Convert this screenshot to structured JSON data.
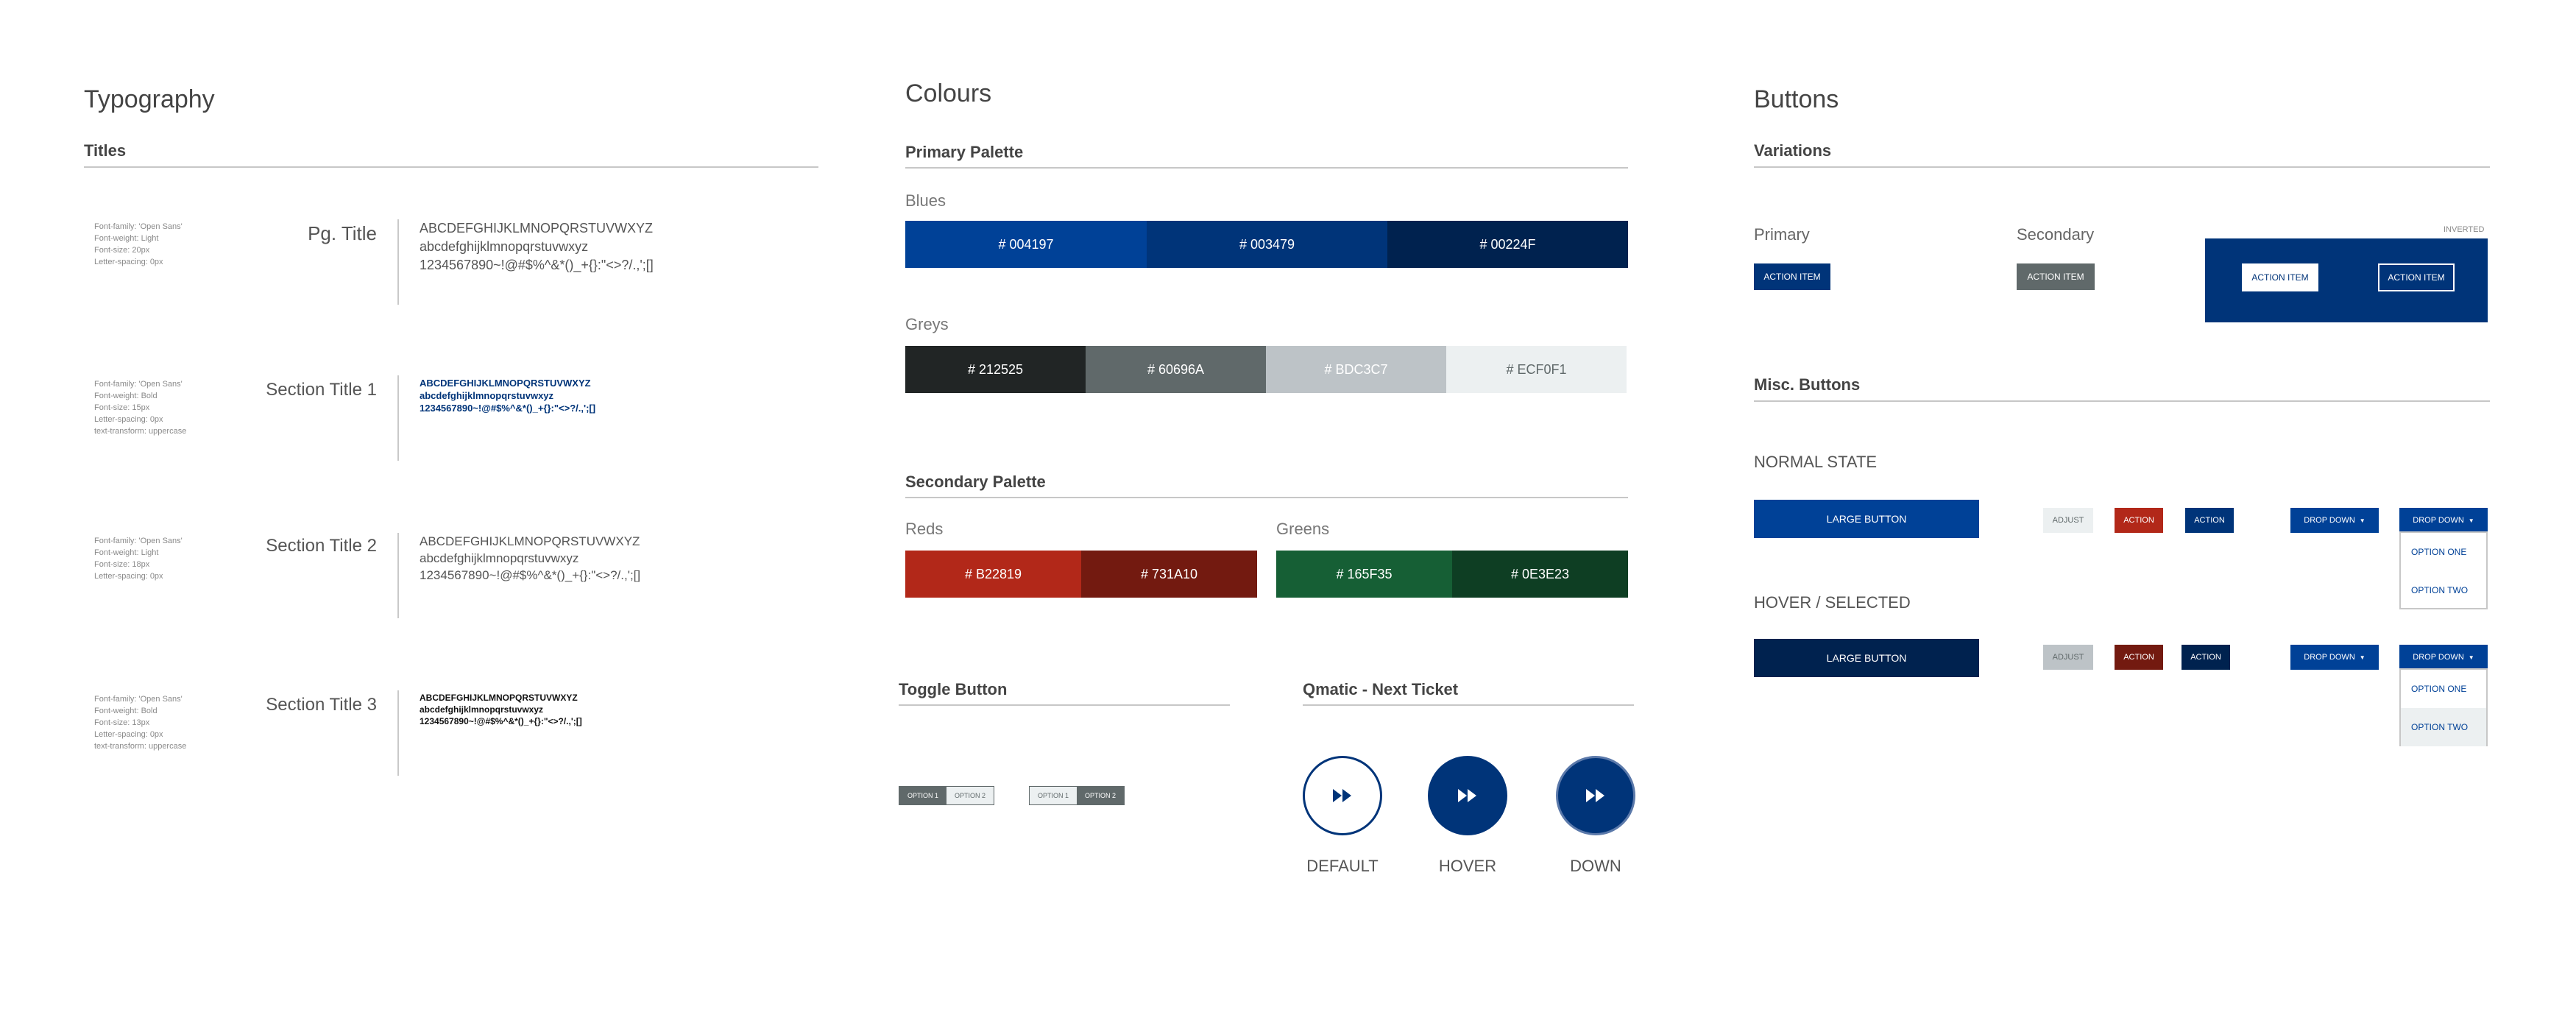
{
  "typography": {
    "heading": "Typography",
    "titles_heading": "Titles",
    "rows": [
      {
        "spec": "Font-family: 'Open Sans'\nFont-weight: Light\nFont-size: 20px\nLetter-spacing: 0px",
        "name": "Pg. Title",
        "sample": "ABCDEFGHIJKLMNOPQRSTUVWXYZ\nabcdefghijklmnopqrstuvwxyz\n1234567890~!@#$%^&*()_+{}:\"<>?/.,';[]"
      },
      {
        "spec": "Font-family: 'Open Sans'\nFont-weight: Bold\nFont-size: 15px\nLetter-spacing: 0px\ntext-transform: uppercase",
        "name": "Section Title 1",
        "sample": "ABCDEFGHIJKLMNOPQRSTUVWXYZ\nabcdefghijklmnopqrstuvwxyz\n1234567890~!@#$%^&*()_+{}:\"<>?/.,';[]"
      },
      {
        "spec": "Font-family: 'Open Sans'\nFont-weight: Light\nFont-size: 18px\nLetter-spacing: 0px",
        "name": "Section Title 2",
        "sample": "ABCDEFGHIJKLMNOPQRSTUVWXYZ\nabcdefghijklmnopqrstuvwxyz\n1234567890~!@#$%^&*()_+{}:\"<>?/.,';[]"
      },
      {
        "spec": "Font-family: 'Open Sans'\nFont-weight: Bold\nFont-size: 13px\nLetter-spacing: 0px\ntext-transform: uppercase",
        "name": "Section Title 3",
        "sample": "ABCDEFGHIJKLMNOPQRSTUVWXYZ\nabcdefghijklmnopqrstuvwxyz\n1234567890~!@#$%^&*()_+{}:\"<>?/.,';[]"
      }
    ]
  },
  "colours": {
    "heading": "Colours",
    "primary_heading": "Primary Palette",
    "blues_label": "Blues",
    "blues": [
      {
        "label": "# 004197",
        "color": "#004197"
      },
      {
        "label": "# 003479",
        "color": "#003479"
      },
      {
        "label": "# 00224F",
        "color": "#00224F"
      }
    ],
    "greys_label": "Greys",
    "greys": [
      {
        "label": "# 212525",
        "color": "#212525",
        "text": "#ffffff"
      },
      {
        "label": "# 60696A",
        "color": "#60696A",
        "text": "#ffffff"
      },
      {
        "label": "# BDC3C7",
        "color": "#BDC3C7",
        "text": "#ffffff"
      },
      {
        "label": "# ECF0F1",
        "color": "#ECF0F1",
        "text": "#60696A"
      }
    ],
    "secondary_heading": "Secondary Palette",
    "reds_label": "Reds",
    "reds": [
      {
        "label": "# B22819",
        "color": "#B22819"
      },
      {
        "label": "# 731A10",
        "color": "#731A10"
      }
    ],
    "greens_label": "Greens",
    "greens": [
      {
        "label": "# 165F35",
        "color": "#165F35"
      },
      {
        "label": "# 0E3E23",
        "color": "#0E3E23"
      }
    ]
  },
  "toggle": {
    "heading": "Toggle Button",
    "option1": "OPTION 1",
    "option2": "OPTION 2"
  },
  "qmatic": {
    "heading": "Qmatic - Next Ticket",
    "states": [
      "DEFAULT",
      "HOVER",
      "DOWN"
    ]
  },
  "buttons": {
    "heading": "Buttons",
    "variations_heading": "Variations",
    "primary_label": "Primary",
    "secondary_label": "Secondary",
    "inverted_label": "INVERTED",
    "action_item": "ACTION ITEM",
    "misc_heading": "Misc. Buttons",
    "normal_state": "NORMAL STATE",
    "hover_state": "HOVER / SELECTED",
    "large_button": "LARGE BUTTON",
    "adjust": "ADJUST",
    "action": "ACTION",
    "drop_down": "DROP DOWN",
    "option_one": "OPTION ONE",
    "option_two": "OPTION TWO"
  }
}
